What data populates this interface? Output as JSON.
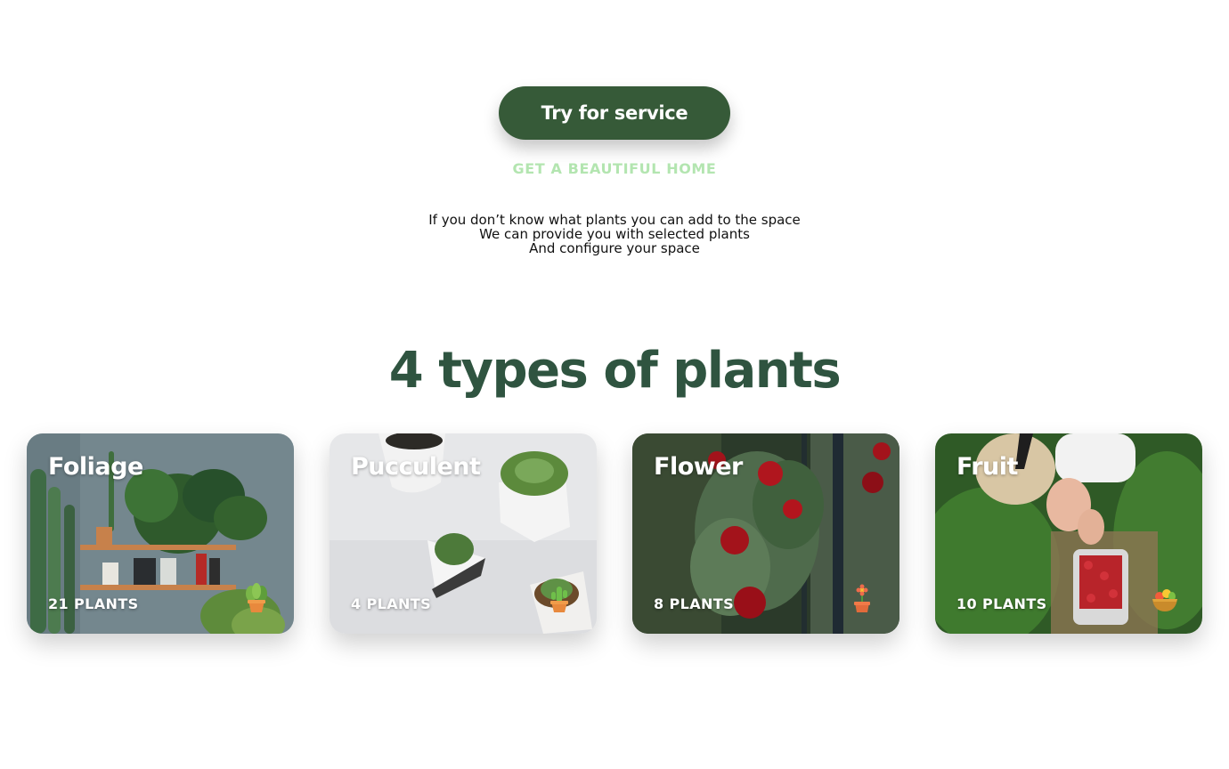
{
  "hero": {
    "cta_label": "Try for service",
    "tagline": "GET A BEAUTIFUL HOME",
    "intro_lines": [
      "If you don’t know what plants you can add to the space",
      "We can provide you with selected plants",
      "And configure your space"
    ]
  },
  "section": {
    "title": "4 types of plants"
  },
  "cards": [
    {
      "title": "Foliage",
      "count": "21 PLANTS",
      "icon": "potted-plant-icon"
    },
    {
      "title": "Pucculent",
      "count": "4 PLANTS",
      "icon": "cactus-pot-icon"
    },
    {
      "title": "Flower",
      "count": "8 PLANTS",
      "icon": "flower-pot-icon"
    },
    {
      "title": "Fruit",
      "count": "10 PLANTS",
      "icon": "fruit-bowl-icon"
    }
  ],
  "colors": {
    "accent": "#365a38",
    "tagline": "#b3e5b0",
    "heading": "#2f5440"
  }
}
